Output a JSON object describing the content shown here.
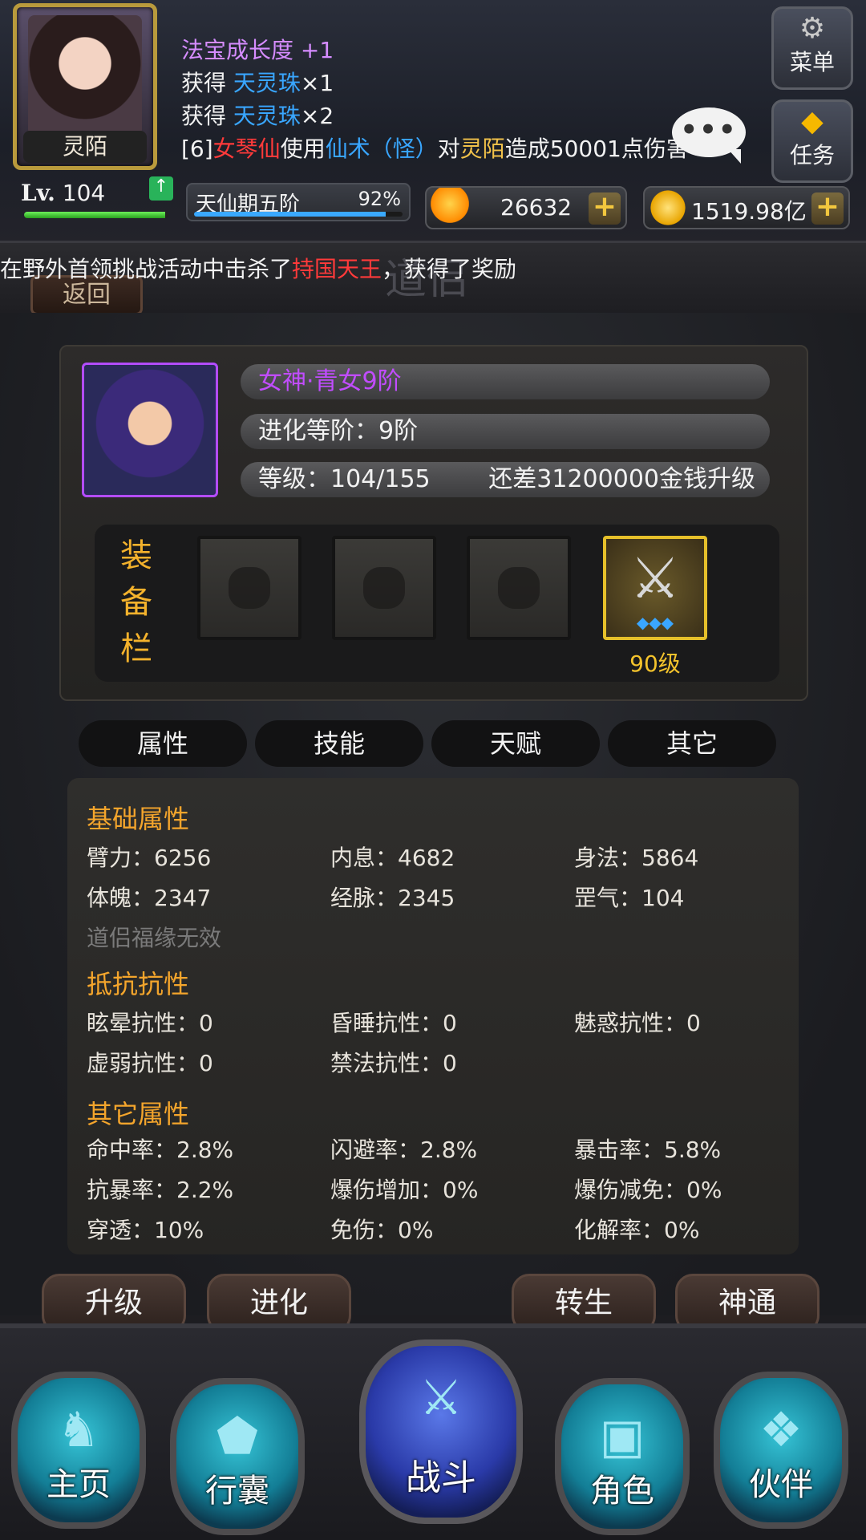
{
  "hud": {
    "avatar_name": "灵陌",
    "chat_lines": [
      [
        {
          "t": "法宝成长度 ",
          "c": "purple"
        },
        {
          "t": "+1",
          "c": "purple"
        }
      ],
      [
        {
          "t": "获得 ",
          "c": "white"
        },
        {
          "t": "天灵珠",
          "c": "blue"
        },
        {
          "t": "×1",
          "c": "white"
        }
      ],
      [
        {
          "t": "获得 ",
          "c": "white"
        },
        {
          "t": "天灵珠",
          "c": "blue"
        },
        {
          "t": "×2",
          "c": "white"
        }
      ],
      [
        {
          "t": "[6]",
          "c": "white"
        },
        {
          "t": "女琴仙",
          "c": "red"
        },
        {
          "t": "使用",
          "c": "white"
        },
        {
          "t": "仙术（怪）",
          "c": "blue"
        },
        {
          "t": "对",
          "c": "white"
        },
        {
          "t": "灵陌",
          "c": "gold"
        },
        {
          "t": "造成50001点伤害",
          "c": "white"
        }
      ]
    ],
    "chat_bubble": "•••",
    "menu_label": "菜单",
    "task_label": "任务",
    "level_prefix": "Lv.",
    "level": "104",
    "level_progress": 0.98,
    "realm_name": "天仙期五阶",
    "realm_pct_text": "92%",
    "realm_progress": 0.92,
    "gems": "26632",
    "gold": "1519.98亿",
    "plus": "+"
  },
  "title": {
    "back_label": "返回",
    "page_title": "道侣",
    "marquee_parts": [
      {
        "t": "在野外首领挑战活动中击杀了",
        "c": "white"
      },
      {
        "t": "持国天王",
        "c": "red"
      },
      {
        "t": "，获得了奖励",
        "c": "white"
      }
    ]
  },
  "hero": {
    "name": "女神·青女9阶",
    "stage": "进化等阶：9阶",
    "level": "等级：104/155",
    "upgrade_cost": "还差31200000金钱升级"
  },
  "equipment": {
    "label": [
      "装",
      "备",
      "栏"
    ],
    "slot4_icon": "⚔",
    "slot4_gems": "◆◆◆",
    "slot4_level": "90级"
  },
  "tabs": [
    "属性",
    "技能",
    "天赋",
    "其它"
  ],
  "stats": {
    "basic_title": "基础属性",
    "basic": [
      "臂力：6256",
      "内息：4682",
      "身法：5864",
      "体魄：2347",
      "经脉：2345",
      "罡气：104"
    ],
    "basic_note": "道侣福缘无效",
    "resist_title": "抵抗抗性",
    "resist": [
      "眩晕抗性：0",
      "昏睡抗性：0",
      "魅惑抗性：0",
      "虚弱抗性：0",
      "禁法抗性：0"
    ],
    "other_title": "其它属性",
    "other": [
      "命中率：2.8%",
      "闪避率：2.8%",
      "暴击率：5.8%",
      "抗暴率：2.2%",
      "爆伤增加：0%",
      "爆伤减免：0%",
      "穿透：10%",
      "免伤：0%",
      "化解率：0%"
    ]
  },
  "actions": [
    "升级",
    "进化",
    "转生",
    "神通"
  ],
  "nav": {
    "home": "主页",
    "bag": "行囊",
    "fight": "战斗",
    "role": "角色",
    "partner": "伙伴"
  },
  "icons": {
    "menu": "gear-icon",
    "task": "diamond-icon",
    "gem": "gem-icon",
    "gold": "coin-icon"
  }
}
